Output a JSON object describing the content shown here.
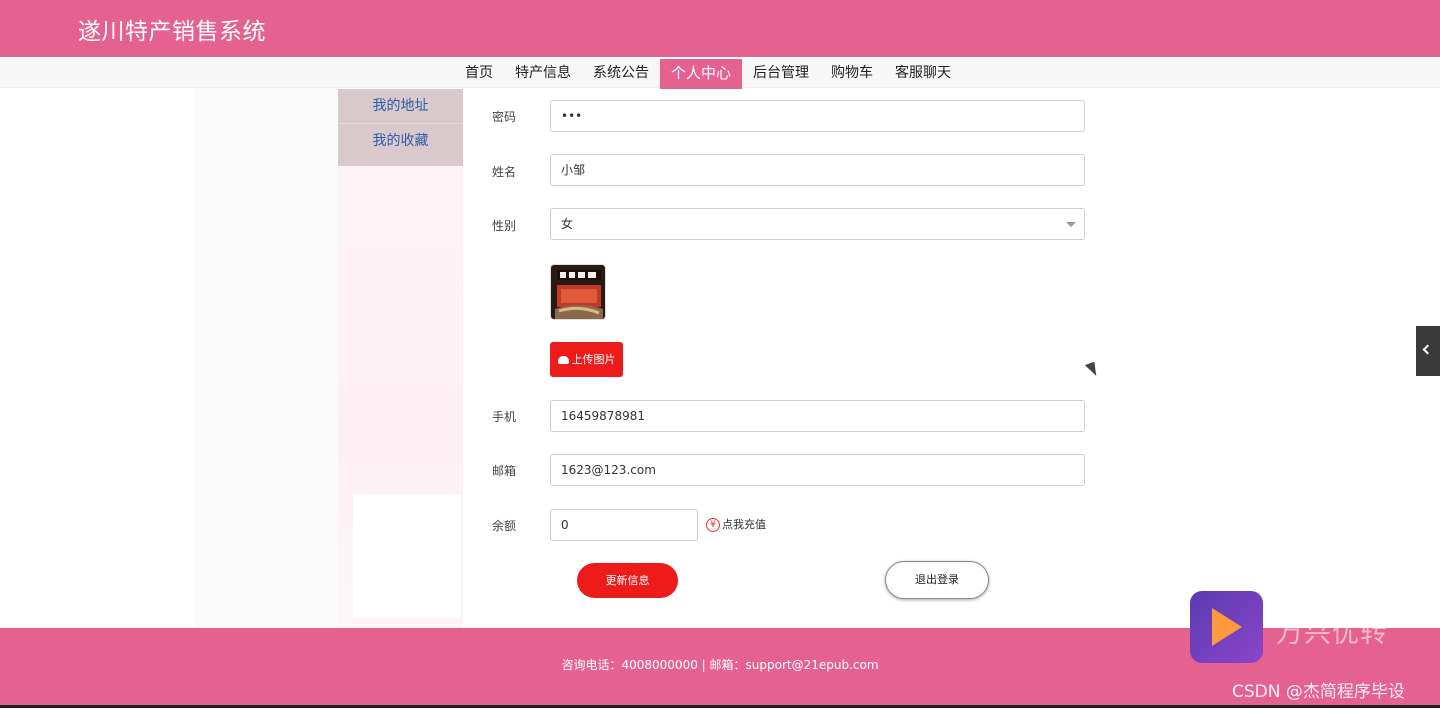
{
  "header": {
    "site_title": "遂川特产销售系统"
  },
  "nav": {
    "items": [
      {
        "label": "首页"
      },
      {
        "label": "特产信息"
      },
      {
        "label": "系统公告"
      },
      {
        "label": "个人中心"
      },
      {
        "label": "后台管理"
      },
      {
        "label": "购物车"
      },
      {
        "label": "客服聊天"
      }
    ],
    "active": "个人中心"
  },
  "sidebar": {
    "items": [
      {
        "label": "我的地址"
      },
      {
        "label": "我的收藏"
      }
    ]
  },
  "form": {
    "password": {
      "label": "密码",
      "value": "•••"
    },
    "name": {
      "label": "姓名",
      "value": "小邹"
    },
    "gender": {
      "label": "性别",
      "value": "女"
    },
    "upload_label": "上传图片",
    "phone": {
      "label": "手机",
      "value": "16459878981"
    },
    "email": {
      "label": "邮箱",
      "value": "1623@123.com"
    },
    "balance": {
      "label": "余额",
      "value": "0"
    },
    "recharge_label": "点我充值",
    "yen_symbol": "¥",
    "update_label": "更新信息",
    "logout_label": "退出登录"
  },
  "footer": {
    "text": "咨询电话：4008000000 | 邮箱：support@21epub.com"
  },
  "watermark": {
    "app_name": "万兴优转",
    "csdn": "CSDN @杰简程序毕设"
  },
  "colors": {
    "brand_pink": "#e56290",
    "button_red": "#ee1b1b",
    "sidebar_link": "#2a5ea8"
  }
}
